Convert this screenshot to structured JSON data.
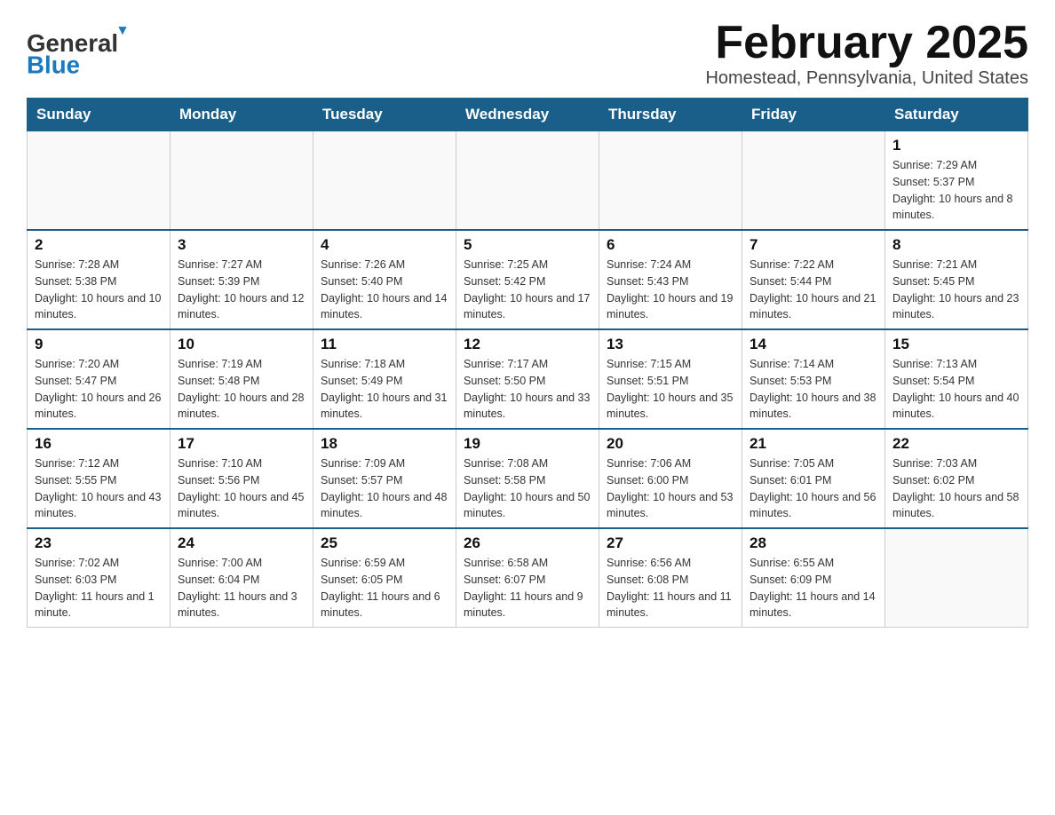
{
  "header": {
    "logo_general": "General",
    "logo_blue": "Blue",
    "title": "February 2025",
    "subtitle": "Homestead, Pennsylvania, United States"
  },
  "days_of_week": [
    "Sunday",
    "Monday",
    "Tuesday",
    "Wednesday",
    "Thursday",
    "Friday",
    "Saturday"
  ],
  "weeks": [
    [
      {
        "day": "",
        "info": ""
      },
      {
        "day": "",
        "info": ""
      },
      {
        "day": "",
        "info": ""
      },
      {
        "day": "",
        "info": ""
      },
      {
        "day": "",
        "info": ""
      },
      {
        "day": "",
        "info": ""
      },
      {
        "day": "1",
        "info": "Sunrise: 7:29 AM\nSunset: 5:37 PM\nDaylight: 10 hours and 8 minutes."
      }
    ],
    [
      {
        "day": "2",
        "info": "Sunrise: 7:28 AM\nSunset: 5:38 PM\nDaylight: 10 hours and 10 minutes."
      },
      {
        "day": "3",
        "info": "Sunrise: 7:27 AM\nSunset: 5:39 PM\nDaylight: 10 hours and 12 minutes."
      },
      {
        "day": "4",
        "info": "Sunrise: 7:26 AM\nSunset: 5:40 PM\nDaylight: 10 hours and 14 minutes."
      },
      {
        "day": "5",
        "info": "Sunrise: 7:25 AM\nSunset: 5:42 PM\nDaylight: 10 hours and 17 minutes."
      },
      {
        "day": "6",
        "info": "Sunrise: 7:24 AM\nSunset: 5:43 PM\nDaylight: 10 hours and 19 minutes."
      },
      {
        "day": "7",
        "info": "Sunrise: 7:22 AM\nSunset: 5:44 PM\nDaylight: 10 hours and 21 minutes."
      },
      {
        "day": "8",
        "info": "Sunrise: 7:21 AM\nSunset: 5:45 PM\nDaylight: 10 hours and 23 minutes."
      }
    ],
    [
      {
        "day": "9",
        "info": "Sunrise: 7:20 AM\nSunset: 5:47 PM\nDaylight: 10 hours and 26 minutes."
      },
      {
        "day": "10",
        "info": "Sunrise: 7:19 AM\nSunset: 5:48 PM\nDaylight: 10 hours and 28 minutes."
      },
      {
        "day": "11",
        "info": "Sunrise: 7:18 AM\nSunset: 5:49 PM\nDaylight: 10 hours and 31 minutes."
      },
      {
        "day": "12",
        "info": "Sunrise: 7:17 AM\nSunset: 5:50 PM\nDaylight: 10 hours and 33 minutes."
      },
      {
        "day": "13",
        "info": "Sunrise: 7:15 AM\nSunset: 5:51 PM\nDaylight: 10 hours and 35 minutes."
      },
      {
        "day": "14",
        "info": "Sunrise: 7:14 AM\nSunset: 5:53 PM\nDaylight: 10 hours and 38 minutes."
      },
      {
        "day": "15",
        "info": "Sunrise: 7:13 AM\nSunset: 5:54 PM\nDaylight: 10 hours and 40 minutes."
      }
    ],
    [
      {
        "day": "16",
        "info": "Sunrise: 7:12 AM\nSunset: 5:55 PM\nDaylight: 10 hours and 43 minutes."
      },
      {
        "day": "17",
        "info": "Sunrise: 7:10 AM\nSunset: 5:56 PM\nDaylight: 10 hours and 45 minutes."
      },
      {
        "day": "18",
        "info": "Sunrise: 7:09 AM\nSunset: 5:57 PM\nDaylight: 10 hours and 48 minutes."
      },
      {
        "day": "19",
        "info": "Sunrise: 7:08 AM\nSunset: 5:58 PM\nDaylight: 10 hours and 50 minutes."
      },
      {
        "day": "20",
        "info": "Sunrise: 7:06 AM\nSunset: 6:00 PM\nDaylight: 10 hours and 53 minutes."
      },
      {
        "day": "21",
        "info": "Sunrise: 7:05 AM\nSunset: 6:01 PM\nDaylight: 10 hours and 56 minutes."
      },
      {
        "day": "22",
        "info": "Sunrise: 7:03 AM\nSunset: 6:02 PM\nDaylight: 10 hours and 58 minutes."
      }
    ],
    [
      {
        "day": "23",
        "info": "Sunrise: 7:02 AM\nSunset: 6:03 PM\nDaylight: 11 hours and 1 minute."
      },
      {
        "day": "24",
        "info": "Sunrise: 7:00 AM\nSunset: 6:04 PM\nDaylight: 11 hours and 3 minutes."
      },
      {
        "day": "25",
        "info": "Sunrise: 6:59 AM\nSunset: 6:05 PM\nDaylight: 11 hours and 6 minutes."
      },
      {
        "day": "26",
        "info": "Sunrise: 6:58 AM\nSunset: 6:07 PM\nDaylight: 11 hours and 9 minutes."
      },
      {
        "day": "27",
        "info": "Sunrise: 6:56 AM\nSunset: 6:08 PM\nDaylight: 11 hours and 11 minutes."
      },
      {
        "day": "28",
        "info": "Sunrise: 6:55 AM\nSunset: 6:09 PM\nDaylight: 11 hours and 14 minutes."
      },
      {
        "day": "",
        "info": ""
      }
    ]
  ]
}
